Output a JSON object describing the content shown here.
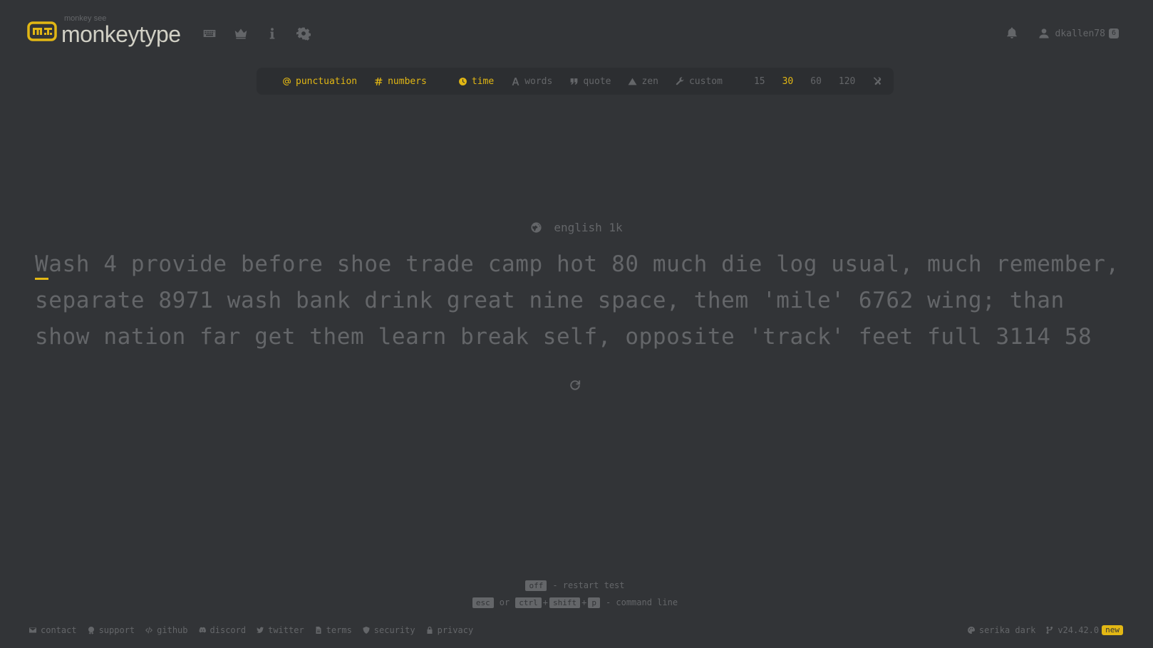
{
  "header": {
    "logo_sub": "monkey see",
    "logo_text": "monkeytype",
    "nav_icons": [
      "keyboard-icon",
      "crown-icon",
      "info-icon",
      "gear-icon"
    ],
    "username": "dkallen78",
    "level": "6"
  },
  "config": {
    "punctuation": "punctuation",
    "numbers": "numbers",
    "modes": [
      "time",
      "words",
      "quote",
      "zen",
      "custom"
    ],
    "active_mode": "time",
    "times": [
      "15",
      "30",
      "60",
      "120"
    ],
    "active_time": "30"
  },
  "test": {
    "language": "english 1k",
    "lines": [
      "Wash 4 provide before shoe trade camp hot 80 much die log usual, much remember,",
      "separate 8971 wash bank drink great nine space, them 'mile' 6762 wing; than",
      "show nation far get them learn break self, opposite 'track' feet full 3114 58"
    ]
  },
  "hints": {
    "key_restart": "off",
    "restart_text": "- restart test",
    "key_esc": "esc",
    "or_text": "or",
    "key_ctrl": "ctrl",
    "key_shift": "shift",
    "key_p": "p",
    "plus": "+",
    "command_text": "- command line"
  },
  "footer": {
    "links": [
      "contact",
      "support",
      "github",
      "discord",
      "twitter",
      "terms",
      "security",
      "privacy"
    ],
    "theme": "serika dark",
    "version": "v24.42.0",
    "new_badge": "new"
  },
  "colors": {
    "bg": "#323437",
    "sub_bg": "#2c2e31",
    "main": "#e2b714",
    "sub": "#646669",
    "text": "#d1d0c5"
  }
}
